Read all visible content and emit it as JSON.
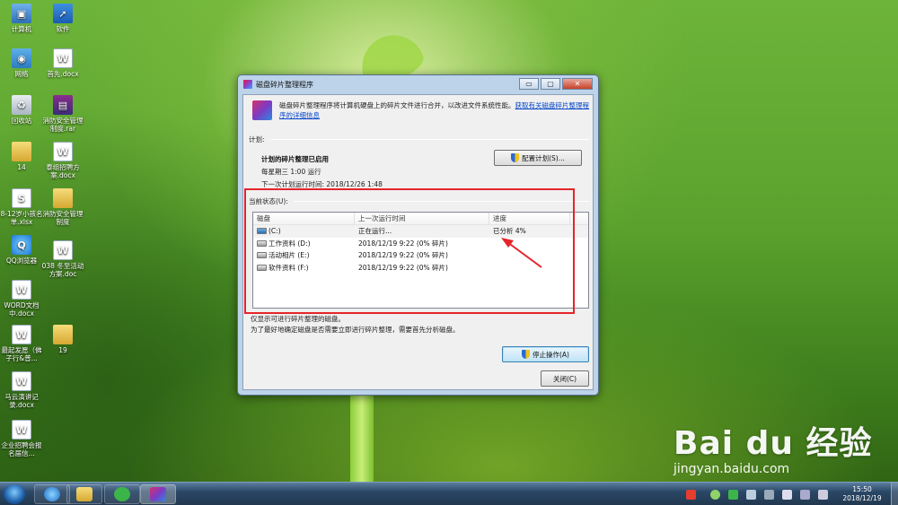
{
  "desktop": {
    "icons": [
      {
        "label": "计算机",
        "glyph": "computer-icon",
        "mark": "▣"
      },
      {
        "label": "软件",
        "glyph": "shortcut-icon",
        "mark": "➚"
      },
      {
        "label": "网络",
        "glyph": "network-icon",
        "mark": "◉"
      },
      {
        "label": "首先.docx",
        "glyph": "word-doc-icon",
        "mark": "W"
      },
      {
        "label": "回收站",
        "glyph": "recycle-bin-icon",
        "mark": "♻"
      },
      {
        "label": "消防安全管理制度.rar",
        "glyph": "rar-archive-icon",
        "mark": "▤"
      },
      {
        "label": "14",
        "glyph": "folder-icon",
        "mark": ""
      },
      {
        "label": "泰组招聘方案.docx",
        "glyph": "word-doc-icon",
        "mark": "W"
      },
      {
        "label": "8-12岁小孩名单.xlsx",
        "glyph": "excel-icon",
        "mark": "S"
      },
      {
        "label": "消防安全管理制度",
        "glyph": "folder-icon",
        "mark": ""
      },
      {
        "label": "QQ浏览器",
        "glyph": "qq-browser-icon",
        "mark": "Q"
      },
      {
        "label": "038 冬至活动方案.doc",
        "glyph": "word-doc-icon",
        "mark": "W"
      },
      {
        "label": "WORD文档中.docx",
        "glyph": "word-doc-icon",
        "mark": "W"
      },
      {
        "label": "最起发愿（佛子行&普...",
        "glyph": "word-doc-icon",
        "mark": "W"
      },
      {
        "label": "19",
        "glyph": "folder-icon",
        "mark": ""
      },
      {
        "label": "马云演讲记录.docx",
        "glyph": "word-doc-icon",
        "mark": "W"
      },
      {
        "label": "企业招聘会报名届信...",
        "glyph": "word-doc-icon",
        "mark": "W"
      }
    ]
  },
  "window": {
    "title": "磁盘碎片整理程序",
    "controls": {
      "minimize": "▭",
      "maximize": "▢",
      "close": "✕"
    },
    "intro_text": "磁盘碎片整理程序将计算机硬盘上的碎片文件进行合并，以改进文件系统性能。",
    "intro_link": "获取有关磁盘碎片整理程序的详细信息",
    "schedule": {
      "section_label": "计划:",
      "status": "计划的碎片整理已启用",
      "run_time": "每星期三  1:00 运行",
      "next_run": "下一次计划运行时间: 2018/12/26 1:48",
      "configure_button": "配置计划(S)..."
    },
    "current_status": {
      "section_label": "当前状态(U):",
      "columns": [
        "磁盘",
        "上一次运行时间",
        "进度"
      ],
      "rows": [
        {
          "disk": "(C:)",
          "last_run": "正在运行...",
          "progress": "已分析 4%",
          "system": true
        },
        {
          "disk": "工作资料 (D:)",
          "last_run": "2018/12/19 9:22 (0% 碎片)",
          "progress": "",
          "system": false
        },
        {
          "disk": "活动相片 (E:)",
          "last_run": "2018/12/19 9:22 (0% 碎片)",
          "progress": "",
          "system": false
        },
        {
          "disk": "软件资料 (F:)",
          "last_run": "2018/12/19 9:22 (0% 碎片)",
          "progress": "",
          "system": false
        }
      ]
    },
    "notes": [
      "仅显示可进行碎片整理的磁盘。",
      "为了最好地确定磁盘是否需要立即进行碎片整理，需要首先分析磁盘。"
    ],
    "stop_button": "停止操作(A)",
    "close_button": "关闭(C)"
  },
  "taskbar": {
    "apps": [
      "ie-browser",
      "file-explorer",
      "wechat",
      "defragmenter"
    ],
    "clock_time": "15:50",
    "clock_date": "2018/12/19"
  },
  "watermark": {
    "brand": "Bai du 经验",
    "url": "jingyan.baidu.com"
  },
  "colors": {
    "highlight_box": "#e5242b",
    "link": "#0645c8",
    "window_frame": "#bcd3ea"
  }
}
